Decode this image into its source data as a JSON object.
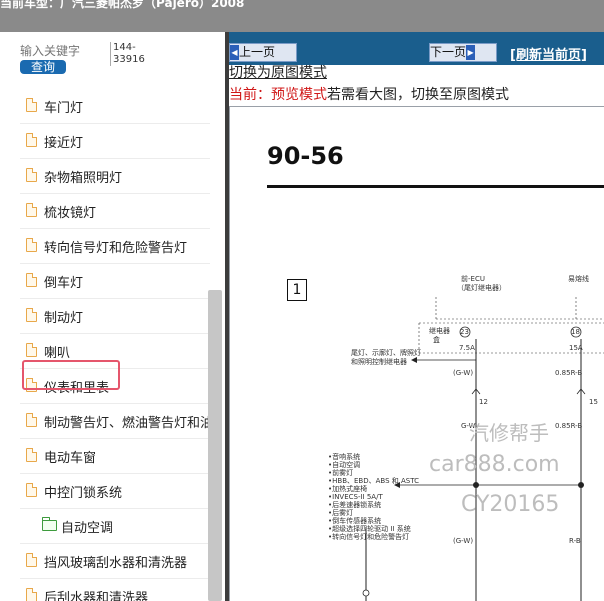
{
  "header": {
    "title": "当前车型：广汽三菱帕杰罗（Pajero）2008"
  },
  "search": {
    "placeholder": "输入关键字",
    "button": "查询",
    "code_line1": "144-",
    "code_line2": "33916"
  },
  "tree": {
    "items": [
      {
        "label": "车门灯",
        "type": "doc"
      },
      {
        "label": "接近灯",
        "type": "doc"
      },
      {
        "label": "杂物箱照明灯",
        "type": "doc"
      },
      {
        "label": "梳妆镜灯",
        "type": "doc"
      },
      {
        "label": "转向信号灯和危险警告灯",
        "type": "doc"
      },
      {
        "label": "倒车灯",
        "type": "doc"
      },
      {
        "label": "制动灯",
        "type": "doc"
      },
      {
        "label": "喇叭",
        "type": "doc"
      },
      {
        "label": "仪表和里表",
        "type": "doc",
        "highlighted": true
      },
      {
        "label": "制动警告灯、燃油警告灯和油",
        "type": "doc"
      },
      {
        "label": "电动车窗",
        "type": "doc"
      },
      {
        "label": "中控门锁系统",
        "type": "doc"
      },
      {
        "label": "自动空调",
        "type": "folder"
      },
      {
        "label": "挡风玻璃刮水器和清洗器",
        "type": "doc"
      },
      {
        "label": "后刮水器和清洗器",
        "type": "doc"
      }
    ]
  },
  "toolbar": {
    "prev": "上一页",
    "next": "下一页",
    "refresh": "[刷新当前页]"
  },
  "mode": {
    "switch_link": "切换为原图模式",
    "current_label": "当前：预览模式",
    "hint": "若需看大图，切换至原图模式"
  },
  "diagram": {
    "page_number": "90-56",
    "box_label": "1",
    "labels": {
      "ecu": "前-ECU",
      "ecu_sub": "（尾灯继电器）",
      "fuse_box": "易熔线",
      "relay_box": "继电器",
      "relay_box2": "盒",
      "fuse23": "23",
      "fuse18": "18",
      "amp1": "7.5A",
      "amp2": "15A",
      "note1": "尾灯、示廓灯、牌照灯",
      "note2": "和照明控制继电器",
      "wire1": "(G-W)",
      "wire2": "0.85R-B",
      "pin12": "12",
      "pin15": "15",
      "wire3": "G-W",
      "wire4": "0.85R-B",
      "wire5": "(G-W)",
      "wire6": "R-B"
    },
    "systems": [
      "•音响系统",
      "•自动空调",
      "•前雾灯",
      "•HBB、EBD、ABS 和 ASTC",
      "•加热式座椅",
      "•INVECS-II 5A/T",
      "•后差速器锁系统",
      "•后雾灯",
      "•倒车传感器系统",
      "•超级选择四轮驱动 II 系统",
      "•转向信号灯和危险警告灯"
    ],
    "watermark": {
      "line1": "汽修帮手",
      "line2": "car888.com",
      "line3": "CY20165"
    }
  }
}
